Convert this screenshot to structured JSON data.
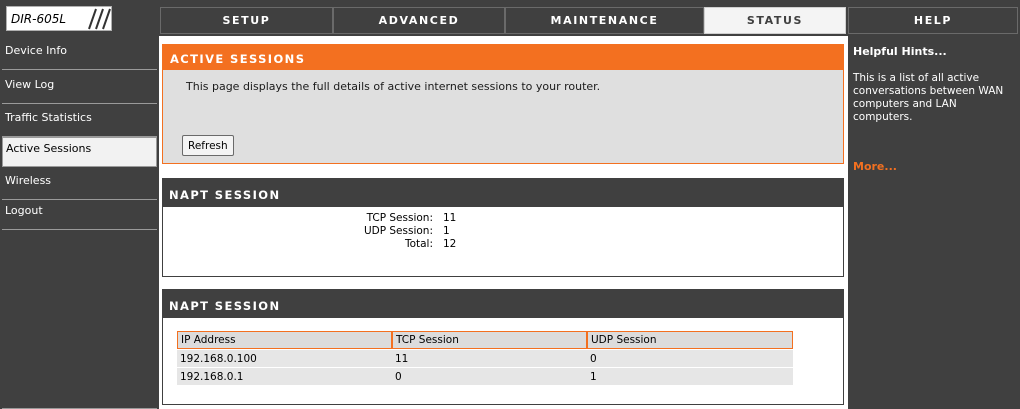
{
  "brand": {
    "model": "DIR-605L"
  },
  "nav": {
    "tabs": [
      {
        "label": "SETUP"
      },
      {
        "label": "ADVANCED"
      },
      {
        "label": "MAINTENANCE"
      },
      {
        "label": "STATUS",
        "active": true
      },
      {
        "label": "HELP"
      }
    ]
  },
  "sidebar": {
    "items": [
      {
        "label": "Device Info"
      },
      {
        "label": "View Log"
      },
      {
        "label": "Traffic Statistics"
      },
      {
        "label": "Active Sessions",
        "active": true
      },
      {
        "label": "Wireless"
      },
      {
        "label": "Logout"
      }
    ]
  },
  "active_sessions": {
    "title": "ACTIVE SESSIONS",
    "description": "This page displays the full details of active internet sessions to your router.",
    "refresh_label": "Refresh"
  },
  "napt_summary": {
    "title": "NAPT SESSION",
    "rows": [
      {
        "label": "TCP Session:",
        "value": "11"
      },
      {
        "label": "UDP Session:",
        "value": "1"
      },
      {
        "label": "Total:",
        "value": "12"
      }
    ]
  },
  "napt_table": {
    "title": "NAPT SESSION",
    "columns": [
      "IP Address",
      "TCP Session",
      "UDP Session"
    ],
    "rows": [
      [
        "192.168.0.100",
        "11",
        "0"
      ],
      [
        "192.168.0.1",
        "0",
        "1"
      ]
    ]
  },
  "help": {
    "title": "Helpful Hints...",
    "body": "This is a list of all active conversations between WAN computers and LAN computers.",
    "more_label": "More..."
  },
  "colors": {
    "accent": "#f37020",
    "dark": "#404040",
    "panel": "#dfdfdf"
  }
}
